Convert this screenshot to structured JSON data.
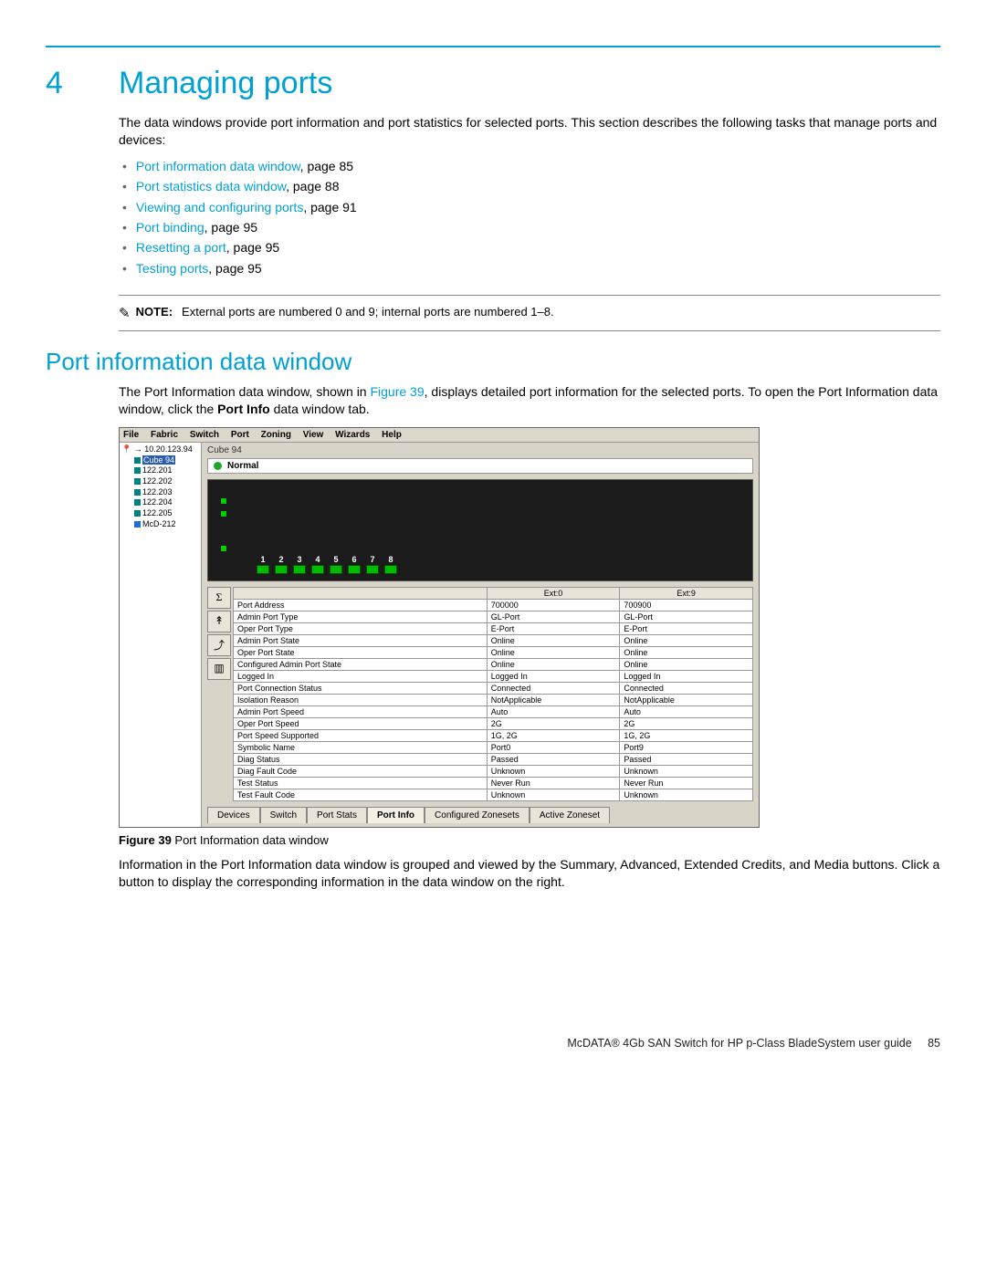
{
  "chapter": {
    "num": "4",
    "title": "Managing ports"
  },
  "intro": "The data windows provide port information and port statistics for selected ports. This section describes the following tasks that manage ports and devices:",
  "toc": [
    {
      "link": "Port information data window",
      "suffix": ", page 85"
    },
    {
      "link": "Port statistics data window",
      "suffix": ", page 88"
    },
    {
      "link": "Viewing and configuring ports",
      "suffix": ", page 91"
    },
    {
      "link": "Port binding",
      "suffix": ", page 95"
    },
    {
      "link": "Resetting a port",
      "suffix": ", page 95"
    },
    {
      "link": "Testing ports",
      "suffix": ", page 95"
    }
  ],
  "note": {
    "label": "NOTE:",
    "text": "External ports are numbered 0 and 9; internal ports are numbered 1–8."
  },
  "section1": {
    "heading": "Port information data window",
    "p1a": "The Port Information data window, shown in ",
    "p1_link": "Figure 39",
    "p1b": ", displays detailed port information for the selected ports. To open the Port Information data window, click the ",
    "p1_bold": "Port Info",
    "p1c": " data window tab."
  },
  "app": {
    "menus": [
      "File",
      "Fabric",
      "Switch",
      "Port",
      "Zoning",
      "View",
      "Wizards",
      "Help"
    ],
    "tree": {
      "root": "10.20.123.94",
      "items": [
        "Cube 94",
        "122.201",
        "122.202",
        "122.203",
        "122.204",
        "122.205",
        "McD-212"
      ],
      "selected": "Cube 94"
    },
    "device_label": "Cube 94",
    "status": "Normal",
    "ports": [
      "1",
      "2",
      "3",
      "4",
      "5",
      "6",
      "7",
      "8"
    ],
    "icons": [
      "Σ",
      "↟",
      "⤴",
      "▥"
    ],
    "table": {
      "headers": [
        "",
        "Ext:0",
        "Ext:9"
      ],
      "rows": [
        [
          "Port Address",
          "700000",
          "700900"
        ],
        [
          "Admin Port Type",
          "GL-Port",
          "GL-Port"
        ],
        [
          "Oper Port Type",
          "E-Port",
          "E-Port"
        ],
        [
          "Admin Port State",
          "Online",
          "Online"
        ],
        [
          "Oper Port State",
          "Online",
          "Online"
        ],
        [
          "Configured Admin Port State",
          "Online",
          "Online"
        ],
        [
          "Logged In",
          "Logged In",
          "Logged In"
        ],
        [
          "Port Connection Status",
          "Connected",
          "Connected"
        ],
        [
          "Isolation Reason",
          "NotApplicable",
          "NotApplicable"
        ],
        [
          "Admin Port Speed",
          "Auto",
          "Auto"
        ],
        [
          "Oper Port Speed",
          "2G",
          "2G"
        ],
        [
          "Port Speed Supported",
          "1G, 2G",
          "1G, 2G"
        ],
        [
          "Symbolic Name",
          "Port0",
          "Port9"
        ],
        [
          "Diag Status",
          "Passed",
          "Passed"
        ],
        [
          "Diag Fault Code",
          "Unknown",
          "Unknown"
        ],
        [
          "Test Status",
          "Never Run",
          "Never Run"
        ],
        [
          "Test Fault Code",
          "Unknown",
          "Unknown"
        ]
      ]
    },
    "tabs": [
      "Devices",
      "Switch",
      "Port Stats",
      "Port Info",
      "Configured Zonesets",
      "Active Zoneset"
    ],
    "active_tab": "Port Info"
  },
  "figure": {
    "label": "Figure 39",
    "caption": " Port Information data window"
  },
  "after_fig": "Information in the Port Information data window is grouped and viewed by the Summary, Advanced, Extended Credits, and Media buttons. Click a button to display the corresponding information in the data window on the right.",
  "footer": {
    "book": "McDATA® 4Gb SAN Switch for HP p-Class BladeSystem user guide",
    "page": "85"
  }
}
